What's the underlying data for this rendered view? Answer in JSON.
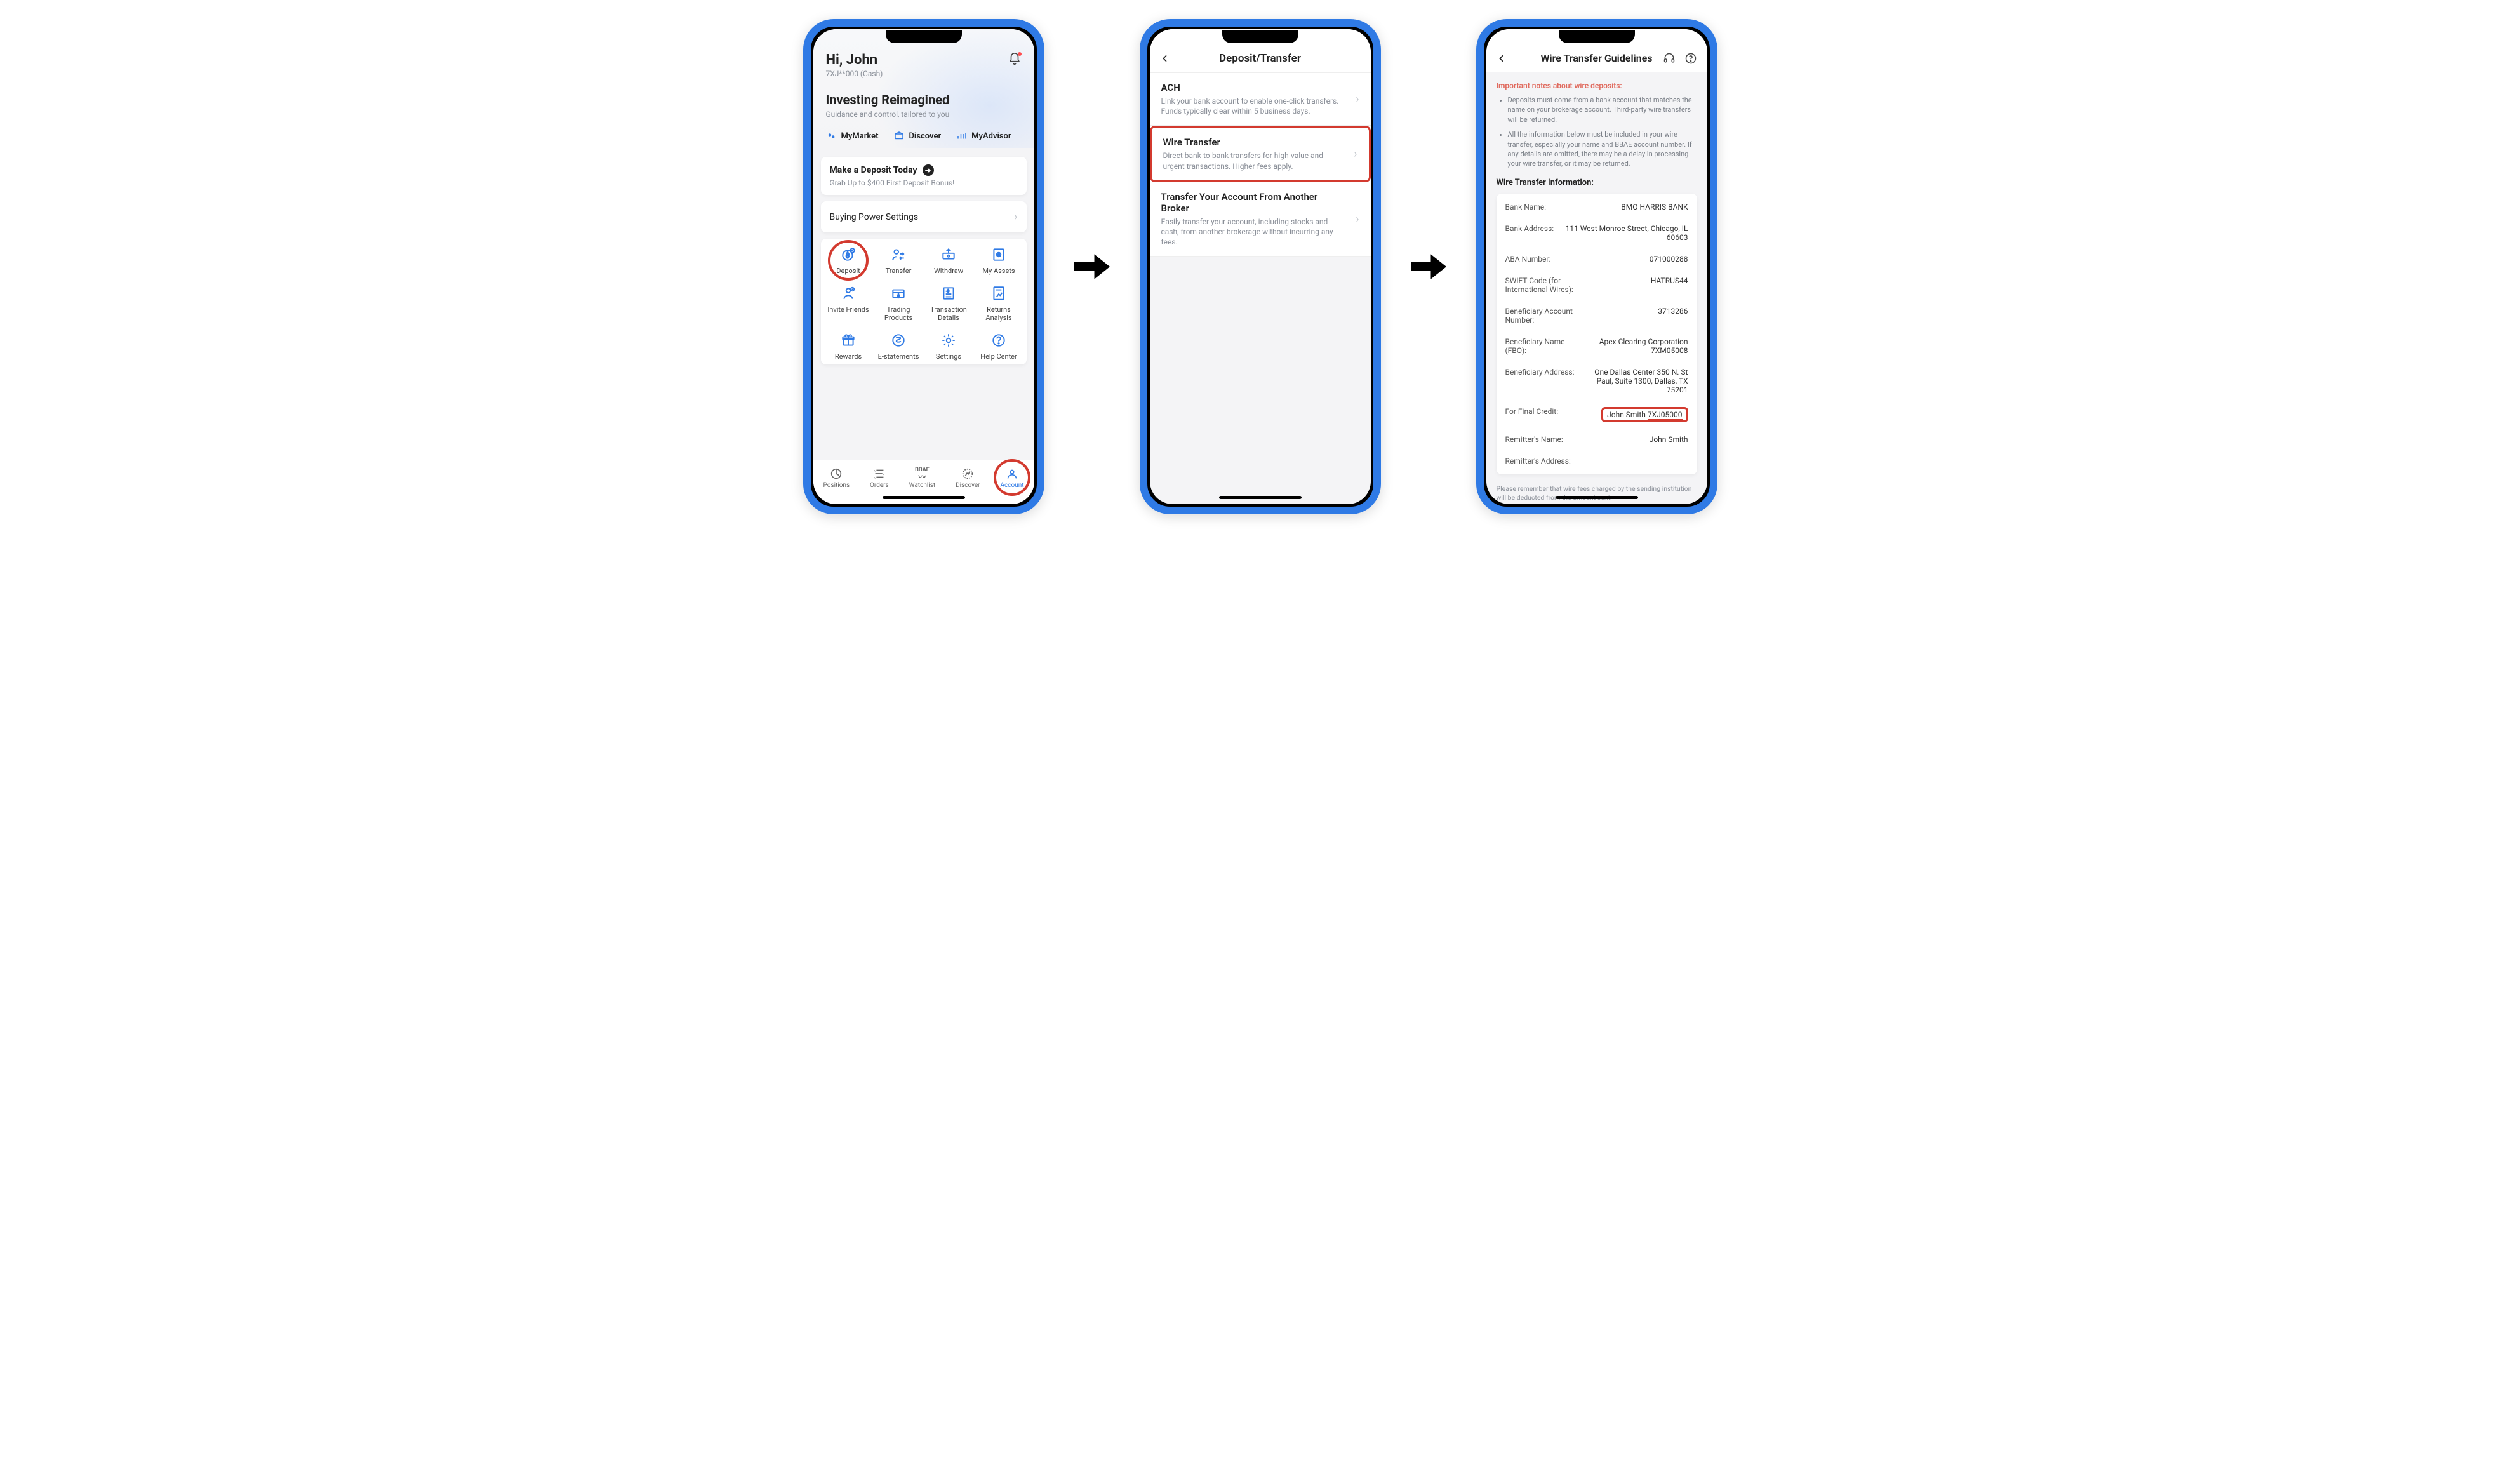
{
  "screen1": {
    "greeting": "Hi, John",
    "account_mask": "7XJ**000 (Cash)",
    "tagline": "Investing Reimagined",
    "tagline_sub": "Guidance and control, tailored to you",
    "quick": {
      "market": "MyMarket",
      "discover": "Discover",
      "advisor": "MyAdvisor"
    },
    "promo_title": "Make a Deposit Today",
    "promo_sub": "Grab Up to $400 First Deposit Bonus!",
    "buying_power": "Buying Power Settings",
    "grid": [
      "Deposit",
      "Transfer",
      "Withdraw",
      "My Assets",
      "Invite Friends",
      "Trading Products",
      "Transaction Details",
      "Returns Analysis",
      "Rewards",
      "E-statements",
      "Settings",
      "Help Center"
    ],
    "tabs": [
      "Positions",
      "Orders",
      "Watchlist",
      "Discover",
      "Account"
    ],
    "watchlist_brand": "BBAE"
  },
  "screen2": {
    "title": "Deposit/Transfer",
    "items": [
      {
        "title": "ACH",
        "sub": "Link your bank account to enable one-click transfers. Funds typically clear within 5 business days."
      },
      {
        "title": "Wire Transfer",
        "sub": "Direct bank-to-bank transfers for high-value and urgent transactions. Higher fees apply."
      },
      {
        "title": "Transfer Your Account From Another Broker",
        "sub": "Easily transfer your account, including stocks and cash, from another brokerage without incurring any fees."
      }
    ]
  },
  "screen3": {
    "title": "Wire Transfer Guidelines",
    "warn": "Important notes about wire deposits:",
    "bullets": [
      "Deposits must come from a bank account that matches the name on your brokerage account. Third-party wire transfers will be returned.",
      "All the information below must be included in your wire transfer, especially your name and BBAE account number.  If any details are omitted, there may be a delay in processing your wire transfer, or it may be returned."
    ],
    "section": "Wire Transfer Information:",
    "rows": {
      "bank_name_k": "Bank Name:",
      "bank_name_v": "BMO HARRIS BANK",
      "bank_addr_k": "Bank Address:",
      "bank_addr_v": "111 West Monroe Street, Chicago, IL 60603",
      "aba_k": "ABA Number:",
      "aba_v": "071000288",
      "swift_k": "SWIFT Code (for International Wires):",
      "swift_v": "HATRUS44",
      "bacct_k": "Beneficiary Account Number:",
      "bacct_v": "3713286",
      "bname_k": "Beneficiary Name (FBO):",
      "bname_v": "Apex Clearing Corporation 7XM05008",
      "baddr_k": "Beneficiary Address:",
      "baddr_v": "One Dallas Center 350 N. St Paul, Suite 1300, Dallas, TX 75201",
      "credit_k": "For Final Credit:",
      "credit_name": "John Smith ",
      "credit_acct": "7XJ05000",
      "rem_name_k": "Remitter's Name:",
      "rem_name_v": "John Smith",
      "rem_addr_k": "Remitter's  Address:",
      "rem_addr_v": ""
    },
    "footer": "Please remember that wire fees charged by the sending institution will be deducted from the amount sent."
  }
}
